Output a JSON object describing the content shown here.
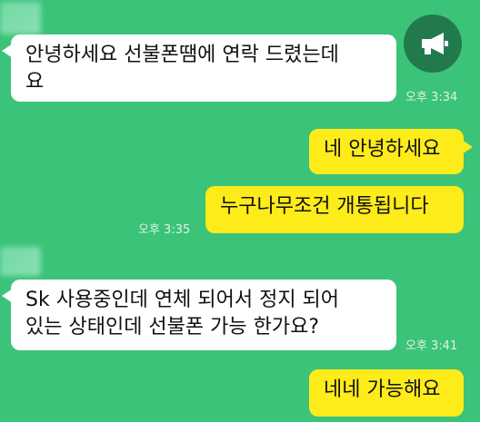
{
  "messages": [
    {
      "direction": "in",
      "text_line1": "안녕하세요 선불폰땜에 연락 드렸는데",
      "text_line2": "요",
      "time": "오후 3:34"
    },
    {
      "direction": "out",
      "text": "네 안녕하세요"
    },
    {
      "direction": "out",
      "text": "누구나무조건 개통됩니다",
      "time": "오후 3:35"
    },
    {
      "direction": "in",
      "text_line1": "Sk  사용중인데 연체 되어서 정지 되어",
      "text_line2": "있는 상태인데 선불폰 가능 한가요?",
      "time": "오후 3:41"
    },
    {
      "direction": "out",
      "text": "네네 가능해요"
    }
  ],
  "colors": {
    "background": "#3cc37a",
    "incoming": "#ffffff",
    "outgoing": "#fdeb1a",
    "avatar": "#227a4c"
  },
  "avatar_icon": "megaphone-icon"
}
